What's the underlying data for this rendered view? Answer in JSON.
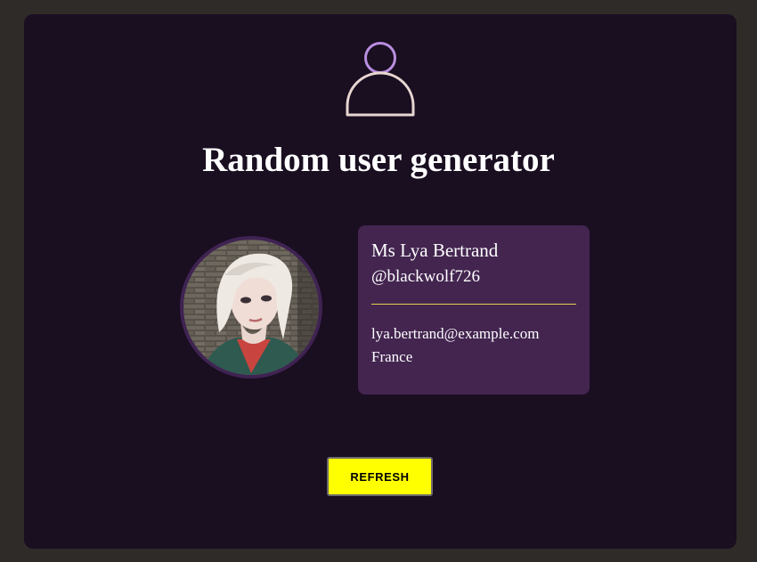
{
  "header": {
    "icon": "user-icon",
    "title": "Random user generator"
  },
  "user": {
    "name": "Ms Lya Bertrand",
    "username": "@blackwolf726",
    "email": "lya.bertrand@example.com",
    "country": "France",
    "photo": "user-avatar-photo"
  },
  "actions": {
    "refresh_label": "REFRESH"
  },
  "colors": {
    "page_background": "#2f2b28",
    "panel_background": "#1a0e21",
    "card_background": "#432550",
    "accent_button": "#ffff00",
    "divider": "#e6d24a",
    "icon_head": "#b98ee0",
    "icon_body": "#e8d6d0"
  }
}
